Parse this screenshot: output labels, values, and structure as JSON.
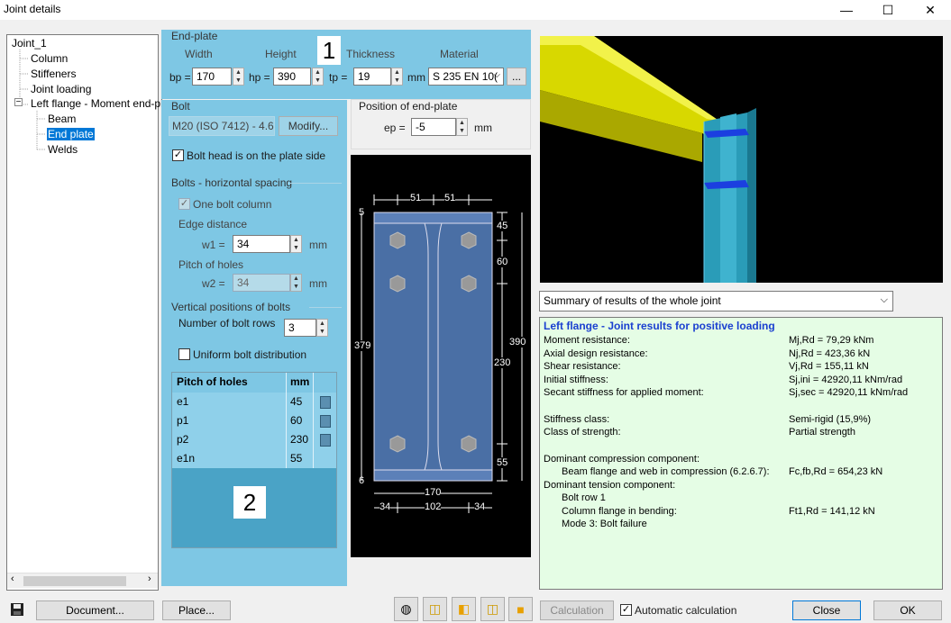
{
  "window": {
    "title": "Joint details",
    "minimize": "—",
    "maximize": "☐",
    "close": "✕"
  },
  "tree": {
    "items": [
      {
        "label": "Joint_1"
      },
      {
        "label": "Column"
      },
      {
        "label": "Stiffeners"
      },
      {
        "label": "Joint loading"
      },
      {
        "label": "Left flange - Moment end-pla"
      },
      {
        "label": "Beam"
      },
      {
        "label": "End plate"
      },
      {
        "label": "Welds"
      }
    ],
    "expander": "⊟"
  },
  "end_plate": {
    "title": "End-plate",
    "width_label": "Width",
    "height_label": "Height",
    "thickness_label": "Thickness",
    "material_label": "Material",
    "bp_label": "bp =",
    "bp": "170",
    "hp_label": "hp =",
    "hp": "390",
    "tp_label": "tp =",
    "tp": "19",
    "mm": "mm",
    "material": "S 235 EN 10(",
    "more": "..."
  },
  "badges": {
    "one": "1",
    "two": "2"
  },
  "bolt": {
    "title": "Bolt",
    "bolt_name": "M20 (ISO 7412) - 4.6",
    "modify": "Modify...",
    "head_on_plate": "Bolt head is on the plate side",
    "horiz_title": "Bolts - horizontal spacing",
    "one_column": "One bolt column",
    "edge_distance": "Edge distance",
    "w1_label": "w1 =",
    "w1": "34",
    "mm": "mm",
    "pitch_label": "Pitch of holes",
    "w2_label": "w2 =",
    "w2": "34",
    "vert_title": "Vertical positions of bolts",
    "rows_label": "Number of bolt rows",
    "rows": "3",
    "uniform": "Uniform bolt distribution"
  },
  "pitch_table": {
    "header": "Pitch of holes",
    "unit": "mm",
    "rows": [
      {
        "name": "e1",
        "value": "45"
      },
      {
        "name": "p1",
        "value": "60"
      },
      {
        "name": "p2",
        "value": "230"
      },
      {
        "name": "e1n",
        "value": "55"
      }
    ]
  },
  "position": {
    "title": "Position of end-plate",
    "ep_label": "ep =",
    "ep": "-5",
    "mm": "mm"
  },
  "drawing": {
    "d51a": "51",
    "d51b": "51",
    "top5": "5",
    "d45": "45",
    "d60": "60",
    "d379": "379",
    "d390": "390",
    "d230": "230",
    "d55": "55",
    "bot6": "6",
    "d170": "170",
    "d34a": "34",
    "d102": "102",
    "d34b": "34"
  },
  "summary": {
    "selected": "Summary of results of the whole joint",
    "heading": "Left flange - Joint results for positive loading",
    "lines": [
      {
        "label": "Moment resistance:",
        "value": "Mj,Rd = 79,29 kNm"
      },
      {
        "label": "Axial design resistance:",
        "value": "Nj,Rd = 423,36 kN"
      },
      {
        "label": "Shear resistance:",
        "value": "Vj,Rd = 155,11 kN"
      },
      {
        "label": "Initial stiffness:",
        "value": "Sj,ini = 42920,11 kNm/rad"
      },
      {
        "label": "Secant stiffness for applied moment:",
        "value": "Sj,sec = 42920,11 kNm/rad"
      },
      {
        "label": "Stiffness class:",
        "value": "Semi-rigid (15,9%)"
      },
      {
        "label": "Class of strength:",
        "value": "Partial strength"
      },
      {
        "label": "Dominant compression component:",
        "value": ""
      },
      {
        "label": "Beam flange and web in compression (6.2.6.7):",
        "value": "Fc,fb,Rd = 654,23 kN"
      },
      {
        "label": "Dominant tension component:",
        "value": ""
      },
      {
        "label": "Bolt row 1",
        "value": ""
      },
      {
        "label": "Column flange in bending:",
        "value": "Ft1,Rd = 141,12 kN"
      },
      {
        "label": "Mode 3: Bolt failure",
        "value": ""
      }
    ]
  },
  "footer": {
    "document": "Document...",
    "place": "Place...",
    "calculation": "Calculation",
    "auto_calc": "Automatic calculation",
    "close": "Close",
    "ok": "OK"
  },
  "colors": {
    "panel_blue": "#7ec7e4",
    "results_bg": "#e5fde5",
    "beam_yellow": "#e8e800",
    "column_cyan": "#2a9cb8"
  }
}
